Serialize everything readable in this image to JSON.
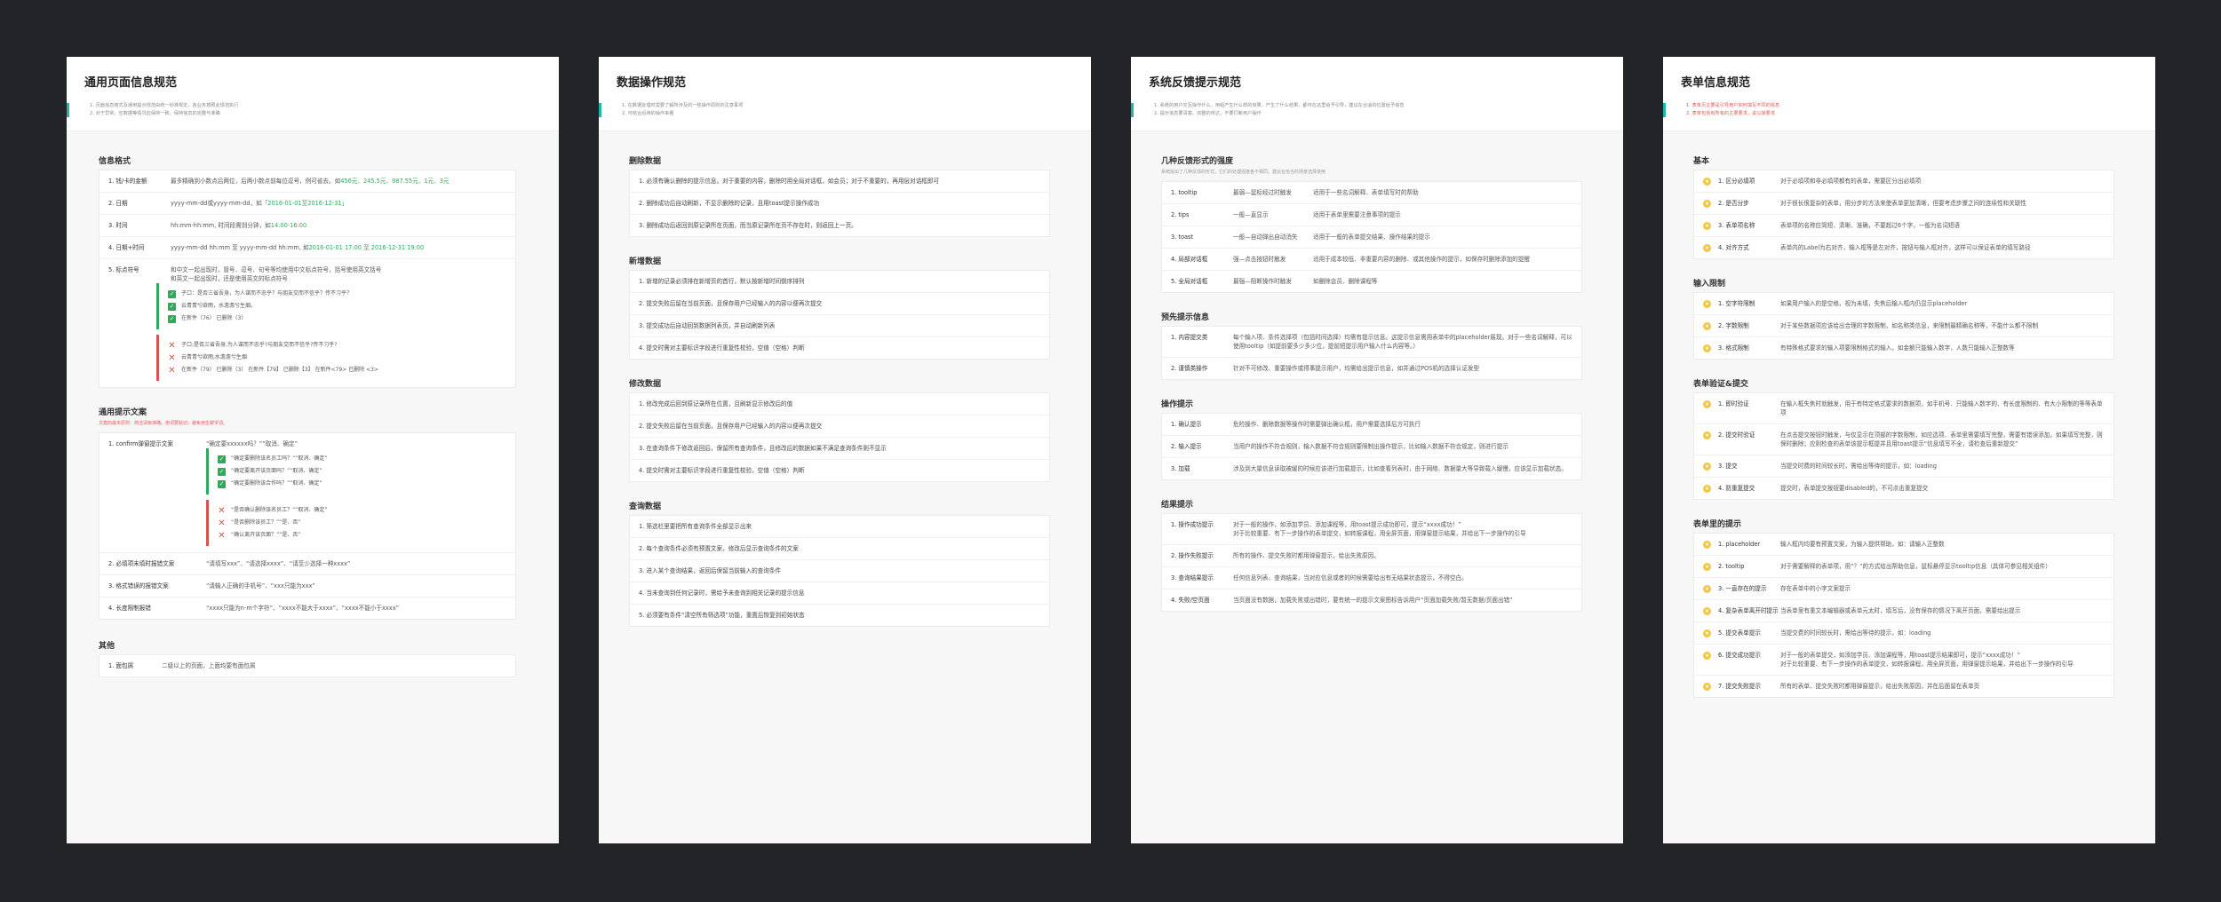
{
  "cards": [
    {
      "title": "通用页面信息规范",
      "desc": [
        "1. 页面信息格式及通用提示规范由统一标准规定，各业务按照此规范执行",
        "2. 对于异常、空数据等情况应保持一致，保持信息的完整与准确"
      ],
      "info": {
        "title": "信息格式",
        "rows": [
          {
            "label": "1. 钱/卡的金额",
            "value": "最多精确到小数点后两位，后两小数点前每位逗号，例可省去。如",
            "ex": "456元、245.5元、987.55元、1元、3元"
          },
          {
            "label": "2. 日期",
            "value": "yyyy-mm-dd或yyyy-mm-dd，如",
            "ex": "「2016-01-01至2016-12-31」"
          },
          {
            "label": "3. 时间",
            "value": "hh:mm-hh:mm, 时间段需到分钟，如",
            "ex": "14:00-16:00"
          },
          {
            "label": "4. 日期+时间",
            "value": "yyyy-mm-dd hh:mm 至 yyyy-mm-dd hh:mm, 如",
            "ex": "2016-01-01 17:00 至 2016-12-31 19:00"
          }
        ],
        "punct": {
          "label": "5. 标点符号",
          "lines": [
            "和中文一起出现时，冒号、逗号、句号等均使用中文标点符号，括号使用英文括号",
            "和英文一起出现时，还是使用英文的标点符号"
          ],
          "good": [
            "子口：是否三省吾身，为人谋而不忠乎？与朋友交而不信乎？传不习乎？",
            "云青青兮欲雨，水澹澹兮生烟。",
            "在新件（76）    已删除（3）"
          ],
          "bad": [
            "子口:是否三省吾身,为人谋而不忠乎?与朋友交而不信乎?传不习乎?",
            "云青青兮欲雨,水澹澹兮生烟",
            "在新件（79）  已删除（3）    在新件【79】   已删除【3】   在新件<79>  已删除 <3>"
          ]
        }
      },
      "prompt": {
        "title": "通用提示文案",
        "subtitle": "文案的最本原则：简洁清晰准确，用词要贴切，避免用生僻字词。",
        "confirm": {
          "label": "1. confirm弹窗提示文案",
          "value": "“确定要xxxxxx吗？”“取消、确定”",
          "good": [
            "“确定要删除该名员工吗？”“取消、确定”",
            "“确定要离开该页面吗？”“取消、确定”",
            "“确定要删除该合作吗？”“取消、确定”"
          ],
          "bad": [
            "“是否确认删除该名员工？”“取消、确定”",
            "“是否删除该员工？”“是、否”",
            "“确认离开该页面？”“是、否”"
          ]
        },
        "rows": [
          {
            "label": "2. 必填项未填时报错文案",
            "value": "“请填写xxx”、“请选择xxxx”、“请至少选择一种xxxx”"
          },
          {
            "label": "3. 格式错误的报错文案",
            "value": "“请输入正确的手机号”、“xxx只能为xxx”"
          },
          {
            "label": "4. 长度限制报错",
            "value": "“xxxx只能为n-m个字符”、“xxxx不能大于xxxx”、“xxxx不能小于xxxx”"
          }
        ]
      },
      "other": {
        "title": "其他",
        "rows": [
          {
            "label": "1. 面包屑",
            "value": "二级以上的页面，上面均要有面包屑"
          }
        ]
      }
    },
    {
      "title": "数据操作规范",
      "desc": [
        "1. 在数据处理时需要了解所涉及的一些操作原则的注意事项",
        "2. 可结合后续的操作来看"
      ],
      "sections": [
        {
          "title": "删除数据",
          "rows": [
            "1. 必须有确认删除的提示信息。对于重要的内容，删除时用全局对话框，如会员；对于不重要的，再用层对话框即可",
            "2. 删除成功后自动刷新，不显示删除的记录，且用toast提示操作成功",
            "3. 删除成功后返回到原记录所在页面，而当原记录所在页不存在时，则返回上一页。"
          ]
        },
        {
          "title": "新增数据",
          "rows": [
            "1. 新增的记录必须排在新增页的首行，默认按新增时间倒序排列",
            "2. 提交失败后留在当前页面，且保存用户已经输入的内容以便再次提交",
            "3. 提交成功后自动回到数据列表页，并自动刷新列表",
            "4. 提交时需对主要标识字段进行重复性校验，空值（空格）判断"
          ]
        },
        {
          "title": "修改数据",
          "rows": [
            "1. 修改完成后回到原记录所在位置，且刷新显示修改后的值",
            "2. 提交失败后留在当前页面，且保存用户已经输入的内容以便再次提交",
            "3. 在查询条件下修改返回后，保留所有查询条件，且修改后的数据如果不满足查询条件则不显示",
            "4. 提交时需对主要标识字段进行重复性校验，空值（空格）判断"
          ]
        },
        {
          "title": "查询数据",
          "rows": [
            "1. 筛选栏里要把所有查询条件全部显示出来",
            "2. 每个查询条件必须有预置文案，修改后显示查询条件的文案",
            "3. 进入某个查询结果，返回后保留当前输入的查询条件",
            "4. 当未查询到任何记录时，需给予未查询到相关记录的提示信息",
            "5. 必须要有条件“清空所有筛选项”功能，重置后恢复到初始状态"
          ]
        }
      ]
    },
    {
      "title": "系统反馈提示规范",
      "desc": [
        "1. 系统的用户交互操作什么，用组产生什么样的效果，产生了什么结果，都可在这里给予引导，建议在合适的位置给予信息",
        "2. 提示信息要清楚、完整的传达，不要打断用户操作"
      ],
      "forms": {
        "title": "几种反馈形式的强度",
        "subtitle": "系统给出了几种反馈的形式，它们的处理强度各不相同，建议在恰当的场景选择使用",
        "rows": [
          {
            "label": "1. tooltip",
            "strength": "最弱—鼠标经过时触发",
            "use": "适用于一些名词解释、表单填写时的帮助"
          },
          {
            "label": "2. tips",
            "strength": "一般—直显示",
            "use": "适用于表单里需要注意事项的提示"
          },
          {
            "label": "3. toast",
            "strength": "一般—自动弹出自动消失",
            "use": "适用于一般的表单提交结果、操作结果的提示"
          },
          {
            "label": "4. 局部对话框",
            "strength": "强—点击按钮时触发",
            "use": "适用于成本较低、非重要内容的删除、或其他操作的提示，如保存时删除添加的提醒"
          },
          {
            "label": "5. 全局对话框",
            "strength": "最强—阻断操作时触发",
            "use": "如删除会员、删除课程等"
          }
        ]
      },
      "prewarn": {
        "title": "预先提示信息",
        "rows": [
          {
            "label": "1. 内容提交类",
            "value": "每个输入项、条件选择项（包括时间选择）均需有提示信息。这提示信息需用表单中的placeholder展现。对于一些名词解释，可以使用tooltip（如提前要多少多少位，提前短提示用户输入什么内容等。）"
          },
          {
            "label": "2. 谨慎类操作",
            "value": "针对不可修改、重要操作或得事提示用户，均需给出提示信息，如并通过POS机的选择认证发型"
          }
        ]
      },
      "ops": {
        "title": "操作提示",
        "rows": [
          {
            "label": "1. 确认提示",
            "value": "危险操作、删除数据等操作时需要弹出确认框，用户需要选择后方可执行"
          },
          {
            "label": "2. 输入提示",
            "value": "当用户的操作不符合规则，输入数据不符合规则要限制出操作提示，比如输入数据不符合规定，则进行提示"
          },
          {
            "label": "3. 加载",
            "value": "涉及到大量信息读取被缓的时候应该进行加载提示，比如查看列表时，由于网络、数据量大等导致载入缓慢，应该显示加载状态。"
          }
        ]
      },
      "results": {
        "title": "结果提示",
        "rows": [
          {
            "label": "1. 操作成功提示",
            "lines": [
              "对于一般的操作，如添加学员、添加课程等，用toast提示成功即可，提示“xxxx成功！”",
              "对于比较重要、有下一步操作的表单提交，如转报课程，用全屏页面，用弹窗提示结果，并给出下一步操作的引导"
            ]
          },
          {
            "label": "2. 操作失败提示",
            "lines": [
              "所有的操作、提交失败时都用弹窗提示，给出失败原因。"
            ]
          },
          {
            "label": "3. 查询结果提示",
            "lines": [
              "任何信息列表、查询结果，当对应信息或者的时候需要给出有无结果状态提示，不得空白。"
            ]
          },
          {
            "label": "4. 失败/空页面",
            "lines": [
              "当页面没有数据，加载失败或出错时，要有统一的提示文案图标告诉用户“页面加载失败/暂无数据/页面出错”"
            ]
          }
        ]
      }
    },
    {
      "title": "表单信息规范",
      "desc": [
        "1. 表单页主要是引导用户如何填写不同的信息",
        "2. 表单包括有所有的主要要求，说以接要求"
      ],
      "basic": {
        "title": "基本",
        "rows": [
          {
            "label": "1. 区分必填项",
            "value": "对于必填项和非必填项都有的表单，需要区分出必填项"
          },
          {
            "label": "2. 是否分步",
            "value": "对于很长很复杂的表单，用分步的方法来使表单更加清晰，但要考虑步骤之间的连续性和关联性"
          },
          {
            "label": "3. 表单项名称",
            "value": "表单项的名称应简短、清晰、准确，不要超过6个字，一般为名词短语"
          },
          {
            "label": "4. 对齐方式",
            "value": "表单内的Label为右对齐，输入框等是左对齐，按钮与输入框对齐，这样可以保证表单的填写路径"
          }
        ]
      },
      "limits": {
        "title": "输入限制",
        "rows": [
          {
            "label": "1. 空字符限制",
            "value": "如果用户输入的是空格，视为未填，失焦后输入框内仍显示placeholder"
          },
          {
            "label": "2. 字数限制",
            "value": "对于某些数据项应该给出合理的字数限制，如名称类信息，来限制最精确名称等，不能什么都不限制"
          },
          {
            "label": "3. 格式限制",
            "value": "有特殊格式要求的输入项要限制格式的输入，如金额只能输入数字，人数只能输入正整数等"
          }
        ]
      },
      "validate": {
        "title": "表单验证&提交",
        "rows": [
          {
            "label": "1. 即时验证",
            "value": "在输入框失焦时就触发，用于有特定格式要求的数据项，如手机号、只能输入数字的、有长度限制的、有大小限制的等等表单项"
          },
          {
            "label": "2. 提交时验证",
            "value": "在点击提交按钮时触发，与仅显示在顶部的字数限制，如应选项、表单里需要填写完整，需要有错误添加，如果填写完整，则保时删除；应则检查的表单该提示框提并且用toast提示“信息填写不全，请检查后重新提交”"
          },
          {
            "label": "3. 提交",
            "value": "当提交时费的时间较长时，需给出等待的提示，如：loading"
          },
          {
            "label": "4. 防重复提交",
            "value": "提交时，表单提交按钮要disabled的，不可点击重复提交"
          }
        ]
      },
      "prompts": {
        "title": "表单里的提示",
        "rows": [
          {
            "label": "1. placeholder",
            "value": "输入框内均要有预置文案，为输入提供帮助，如：请输入正整数"
          },
          {
            "label": "2. tooltip",
            "value": "对于需要解释的表单项，用“？”的方式给出帮助信息，鼠标悬停显示tooltip信息（具体可参见相关组件）"
          },
          {
            "label": "3. 一直存在的提示",
            "value": "存在表单中的小字文案提示"
          },
          {
            "label": "4. 复杂表单离开时提示",
            "value": "当表单里有重文本编辑器或表单元太时，填写后，没有保存的情况下离开页面，需要给出提示"
          },
          {
            "label": "5. 提交表单提示",
            "value": "当提交费的时间较长时，需给出等待的提示，如：loading"
          },
          {
            "label": "6. 提交成功提示",
            "lines": [
              "对于一般的表单提交，如添加学员、添加课程等，用toast提示结果即可，提示“xxxx成功！”",
              "对于比较重要、有下一步操作的表单提交，如转报课程，用全屏页面，用弹窗提示结果，并给出下一步操作的引导"
            ]
          },
          {
            "label": "7. 提交失败提示",
            "value": "所有的表单、提交失败时都用弹窗提示，给出失败原因，并在后面留在表单页"
          }
        ]
      }
    }
  ]
}
